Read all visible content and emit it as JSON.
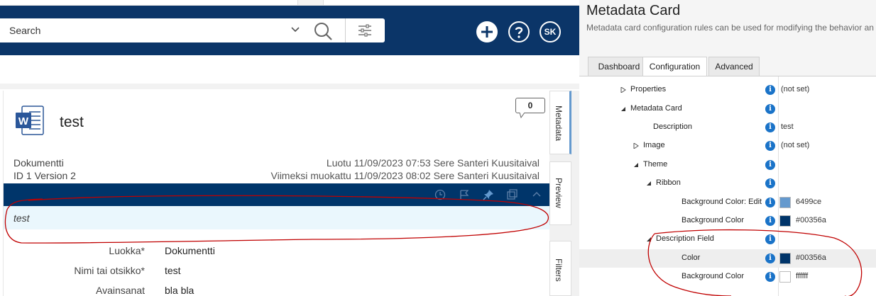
{
  "search": {
    "placeholder": "Search"
  },
  "header": {
    "user_initials": "SK"
  },
  "object": {
    "title": "test",
    "comment_count": "0",
    "type_label": "Dokumentti",
    "id_version": "ID 1  Version 2",
    "created": "Luotu 11/09/2023 07:53 Sere Santeri Kuusitaival",
    "modified": "Viimeksi muokattu 11/09/2023 08:02 Sere Santeri Kuusitaival",
    "description": "test",
    "properties": [
      {
        "label": "Luokka*",
        "value": "Dokumentti"
      },
      {
        "label": "Nimi tai otsikko*",
        "value": "test"
      },
      {
        "label": "Avainsanat",
        "value": "bla bla"
      }
    ]
  },
  "side_tabs": [
    "Metadata",
    "Preview",
    "Filters"
  ],
  "config": {
    "title": "Metadata Card",
    "description": "Metadata card configuration rules can be used for modifying the behavior an",
    "tabs": [
      "Dashboard",
      "Configuration",
      "Advanced"
    ],
    "active_tab": "Configuration",
    "tree": [
      {
        "label": "Properties",
        "value": "(not set)",
        "arrow": "collapsed"
      },
      {
        "label": "Metadata Card",
        "value": "",
        "arrow": "expanded"
      },
      {
        "label": "Description",
        "value": "test",
        "arrow": "none"
      },
      {
        "label": "Image",
        "value": "(not set)",
        "arrow": "collapsed"
      },
      {
        "label": "Theme",
        "value": "",
        "arrow": "expanded"
      },
      {
        "label": "Ribbon",
        "value": "",
        "arrow": "expanded"
      },
      {
        "label": "Background Color: Edit",
        "value": "6499ce",
        "swatch": "#6499ce",
        "arrow": "none"
      },
      {
        "label": "Background Color",
        "value": "#00356a",
        "swatch": "#00356a",
        "arrow": "none"
      },
      {
        "label": "Description Field",
        "value": "",
        "arrow": "expanded"
      },
      {
        "label": "Color",
        "value": "#00356a",
        "swatch": "#00356a",
        "arrow": "none"
      },
      {
        "label": "Background Color",
        "value": "ffffff",
        "swatch": "#ffffff",
        "arrow": "none"
      }
    ]
  },
  "colors": {
    "topbar": "#0b3568",
    "ribbon": "#00356a",
    "ribbon_edit": "#6499ce",
    "description_bg": "#eaf7fd",
    "info": "#1a73c8",
    "annotation": "#c00000"
  }
}
